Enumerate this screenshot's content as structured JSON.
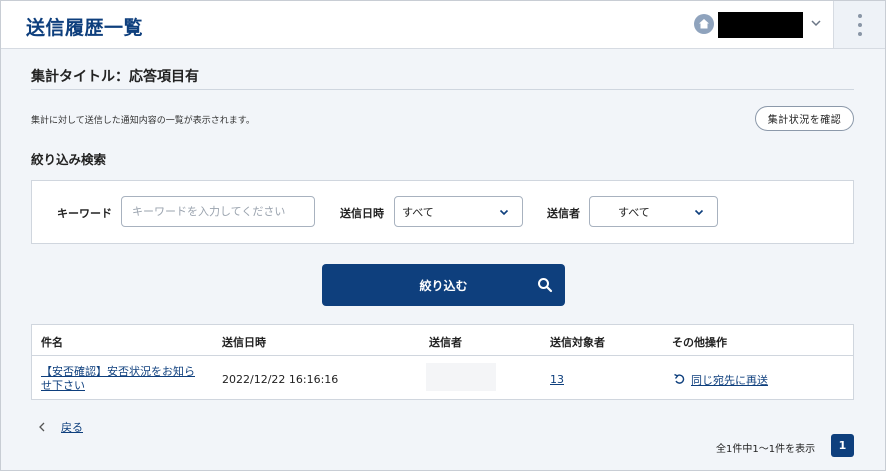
{
  "header": {
    "title": "送信履歴一覧"
  },
  "summary": {
    "title": "集計タイトル：応答項目有",
    "description": "集計に対して送信した通知内容の一覧が表示されます。",
    "status_button": "集計状況を確認"
  },
  "filter": {
    "title": "絞り込み検索",
    "keyword_label": "キーワード",
    "keyword_placeholder": "キーワードを入力してください",
    "keyword_value": "",
    "date_label": "送信日時",
    "date_value": "すべて",
    "sender_label": "送信者",
    "sender_value": "すべて",
    "submit_label": "絞り込む"
  },
  "table": {
    "headers": [
      "件名",
      "送信日時",
      "送信者",
      "送信対象者",
      "その他操作"
    ],
    "rows": [
      {
        "subject_line1": "【安否確認】安否状況をお知ら",
        "subject_line2": "せ下さい",
        "sent_at": "2022/12/22 16:16:16",
        "sender": "",
        "recipients": "13",
        "action": "同じ宛先に再送"
      }
    ]
  },
  "footer": {
    "back_label": "戻る",
    "pagination_info": "全1件中1～1件を表示",
    "current_page": "1"
  },
  "icons": {
    "home": "home-icon",
    "menu": "kebab-menu-icon",
    "search": "search-icon",
    "resend": "resend-icon"
  },
  "colors": {
    "primary": "#0e3f7d",
    "background": "#f2f5f9"
  }
}
